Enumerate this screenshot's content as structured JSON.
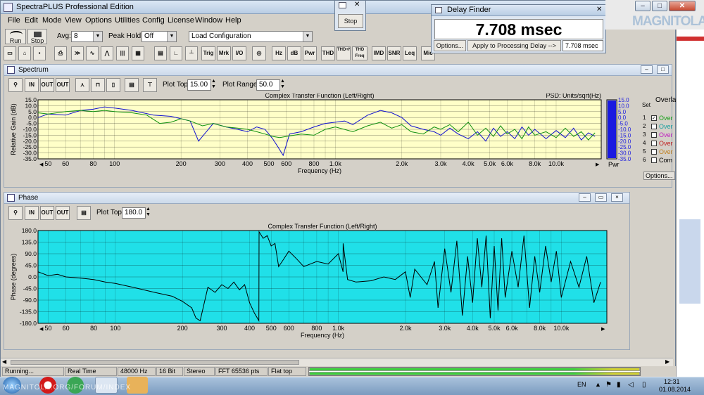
{
  "app": {
    "title": "SpectraPLUS Professional Edition",
    "menu": [
      "File",
      "Edit",
      "Mode",
      "View",
      "Options",
      "Utilities",
      "Config",
      "License",
      "Window",
      "Help"
    ]
  },
  "controls": {
    "run_label": "Run",
    "stop_label": "Stop",
    "avg_label": "Avg:",
    "avg_value": "8",
    "peak_hold_label": "Peak Hold:",
    "peak_hold_value": "Off",
    "config_value": "Load Configuration"
  },
  "toolbar": [
    "Trig",
    "Mrk",
    "I/O",
    "Hz",
    "dB",
    "Pwr",
    "THD",
    "THD+N",
    "THD Freq",
    "IMD",
    "SNR",
    "Leq",
    "Mic"
  ],
  "stop_window": {
    "stop_label": "Stop"
  },
  "delay_finder": {
    "title": "Delay Finder",
    "value": "7.708 msec",
    "options_label": "Options...",
    "apply_label": "Apply to Processing Delay -->",
    "readout": "7.708 msec"
  },
  "spectrum": {
    "title": "Spectrum",
    "plot_top_label": "Plot Top:",
    "plot_top_value": "15.00",
    "plot_range_label": "Plot Range:",
    "plot_range_value": "50.0",
    "chart_title": "Complex Transfer Function (Left/Right)",
    "psd_label": "PSD: Units/sqrt(Hz)",
    "ylabel": "Relative Gain (dB)",
    "xlabel": "Frequency (Hz)",
    "pwr_label": "Pwr",
    "overlay_header": "Overla",
    "overlay_items": [
      "Over",
      "Over",
      "Over",
      "Over",
      "Over",
      "Com"
    ],
    "overlay_numbers": [
      "Set",
      "1",
      "2",
      "3",
      "4",
      "5",
      "6"
    ],
    "overlay_colors": [
      "#19a019",
      "#19a0a0",
      "#c020c0",
      "#c02020",
      "#c08020",
      "#000000"
    ],
    "options_label": "Options..."
  },
  "phase": {
    "title": "Phase",
    "plot_top_label": "Plot Top:",
    "plot_top_value": "180.0",
    "chart_title": "Complex Transfer Function (Left/Right)",
    "ylabel": "Phase (degrees)",
    "xlabel": "Frequency (Hz)"
  },
  "chart_data": [
    {
      "type": "line",
      "title": "Complex Transfer Function (Left/Right)",
      "xlabel": "Frequency (Hz)",
      "ylabel": "Relative Gain (dB)",
      "x_scale": "log",
      "xlim": [
        45,
        16000
      ],
      "ylim": [
        -35,
        15
      ],
      "x_ticks": [
        50,
        60,
        80,
        100,
        200,
        300,
        400,
        500,
        600,
        800,
        1000,
        2000,
        3000,
        4000,
        5000,
        6000,
        8000,
        10000
      ],
      "x_tick_labels": [
        "50",
        "60",
        "80",
        "100",
        "200",
        "300",
        "400",
        "500",
        "600",
        "800",
        "1.0k",
        "2.0k",
        "3.0k",
        "4.0k",
        "5.0k",
        "6.0k",
        "8.0k",
        "10.0k"
      ],
      "y_ticks": [
        15,
        10,
        5,
        0,
        -5,
        -10,
        -15,
        -20,
        -25,
        -30,
        -35
      ],
      "y_tick_labels": [
        "15.0",
        "10.0",
        "5.0",
        "0.0",
        "-5.0",
        "-10.0",
        "-15.0",
        "-20.0",
        "-25.0",
        "-30.0",
        "-35.0"
      ],
      "background": "#ffffc8",
      "grid": true,
      "series": [
        {
          "color": "#1010d0",
          "x": [
            45,
            50,
            60,
            70,
            80,
            90,
            100,
            120,
            150,
            180,
            200,
            220,
            240,
            280,
            320,
            360,
            400,
            440,
            480,
            520,
            550,
            580,
            620,
            700,
            800,
            900,
            1000,
            1100,
            1200,
            1400,
            1600,
            1800,
            2000,
            2200,
            2500,
            2800,
            3000,
            3300,
            3600,
            4000,
            4400,
            4800,
            5200,
            5600,
            6000,
            6500,
            7000,
            7500,
            8000,
            9000,
            10000,
            11000,
            12000,
            13000,
            14000,
            15000
          ],
          "y": [
            0,
            3,
            2,
            6,
            7,
            9,
            8,
            6,
            2,
            1,
            -1,
            -3,
            -20,
            -5,
            -8,
            -10,
            -12,
            -8,
            -10,
            -18,
            -25,
            -32,
            -14,
            -12,
            -8,
            -5,
            -4,
            -3,
            -6,
            2,
            6,
            4,
            0,
            -7,
            -10,
            -12,
            -15,
            -9,
            -14,
            -18,
            -12,
            -20,
            -9,
            -16,
            -12,
            -18,
            -8,
            -15,
            -10,
            -18,
            -11,
            -17,
            -9,
            -19,
            -13,
            -16
          ]
        },
        {
          "color": "#109010",
          "x": [
            45,
            50,
            60,
            70,
            80,
            90,
            100,
            120,
            140,
            160,
            180,
            200,
            220,
            250,
            280,
            320,
            360,
            400,
            440,
            480,
            520,
            560,
            600,
            700,
            800,
            900,
            1000,
            1200,
            1400,
            1600,
            1800,
            2000,
            2200,
            2500,
            2800,
            3000,
            3300,
            3600,
            4000,
            4400,
            4800,
            5200,
            5600,
            6000,
            6500,
            7000,
            7500,
            8000,
            9000,
            10000,
            11000,
            12000,
            13000,
            14000,
            15000
          ],
          "y": [
            4,
            3,
            5,
            6,
            5,
            6,
            5,
            4,
            2,
            -5,
            -4,
            -1,
            -3,
            -7,
            -5,
            -8,
            -9,
            -10,
            -12,
            -14,
            -16,
            -17,
            -16,
            -14,
            -15,
            -10,
            -8,
            -12,
            -7,
            -4,
            -9,
            -6,
            -12,
            -14,
            -8,
            -10,
            -6,
            -12,
            -4,
            -15,
            -9,
            -16,
            -7,
            -14,
            -10,
            -18,
            -8,
            -15,
            -12,
            -17,
            -9,
            -16,
            -12,
            -19,
            -13
          ]
        }
      ]
    },
    {
      "type": "line",
      "title": "Complex Transfer Function (Left/Right)",
      "xlabel": "Frequency (Hz)",
      "ylabel": "Phase (degrees)",
      "x_scale": "log",
      "xlim": [
        45,
        16000
      ],
      "ylim": [
        -180,
        180
      ],
      "x_ticks": [
        50,
        60,
        80,
        100,
        200,
        300,
        400,
        500,
        600,
        800,
        1000,
        2000,
        3000,
        4000,
        5000,
        6000,
        8000,
        10000
      ],
      "x_tick_labels": [
        "50",
        "60",
        "80",
        "100",
        "200",
        "300",
        "400",
        "500",
        "600",
        "800",
        "1.0k",
        "2.0k",
        "3.0k",
        "4.0k",
        "5.0k",
        "6.0k",
        "8.0k",
        "10.0k"
      ],
      "y_ticks": [
        180,
        135,
        90,
        45,
        0,
        -45,
        -90,
        -135,
        -180
      ],
      "y_tick_labels": [
        "180.0",
        "135.0",
        "90.0",
        "45.0",
        "0.0",
        "-45.0",
        "-90.0",
        "-135.0",
        "-180.0"
      ],
      "background": "#20e0e8",
      "grid": true,
      "series": [
        {
          "color": "#000000",
          "x": [
            45,
            50,
            55,
            60,
            70,
            80,
            90,
            100,
            120,
            150,
            180,
            200,
            220,
            230,
            240,
            260,
            280,
            300,
            320,
            340,
            360,
            380,
            400,
            420,
            440,
            441,
            460,
            480,
            500,
            520,
            540,
            560,
            600,
            650,
            700,
            800,
            900,
            1000,
            1050,
            1051,
            1100,
            1200,
            1400,
            1600,
            1800,
            2000,
            2100,
            2200,
            2500,
            2700,
            2800,
            3000,
            3200,
            3400,
            3600,
            3800,
            4000,
            4200,
            4400,
            4600,
            4800,
            5000,
            5200,
            5400,
            5600,
            6000,
            6400,
            6800,
            7200,
            7600,
            8000,
            8500,
            9000,
            9500,
            10000,
            11000,
            12000,
            13000,
            14000,
            15000
          ],
          "y": [
            20,
            5,
            10,
            0,
            -5,
            -10,
            -20,
            -25,
            -40,
            -60,
            -75,
            -95,
            -120,
            -160,
            -170,
            -40,
            -60,
            -30,
            -45,
            -20,
            -50,
            -30,
            -100,
            -140,
            -170,
            175,
            150,
            160,
            120,
            130,
            40,
            60,
            100,
            70,
            40,
            60,
            50,
            90,
            20,
            130,
            -10,
            -20,
            -15,
            0,
            -10,
            20,
            -80,
            30,
            -30,
            60,
            -120,
            110,
            -60,
            140,
            -150,
            80,
            -100,
            150,
            -40,
            160,
            -160,
            120,
            -130,
            150,
            -80,
            100,
            -40,
            160,
            -120,
            80,
            -60,
            120,
            -20,
            100,
            -80,
            60,
            -40,
            80,
            -100,
            -20
          ]
        }
      ]
    }
  ],
  "status": {
    "items": [
      "Running...",
      "Real Time",
      "48000 Hz",
      "16 Bit",
      "Stereo",
      "FFT 65536 pts",
      "Flat top"
    ]
  },
  "watermark": "MAGNITOLA",
  "taskbar": {
    "lang": "EN",
    "time": "12:31",
    "date": "01.08.2014",
    "overlay_text": "MAGNITOLA.ORG/FORUM/INDEX"
  }
}
